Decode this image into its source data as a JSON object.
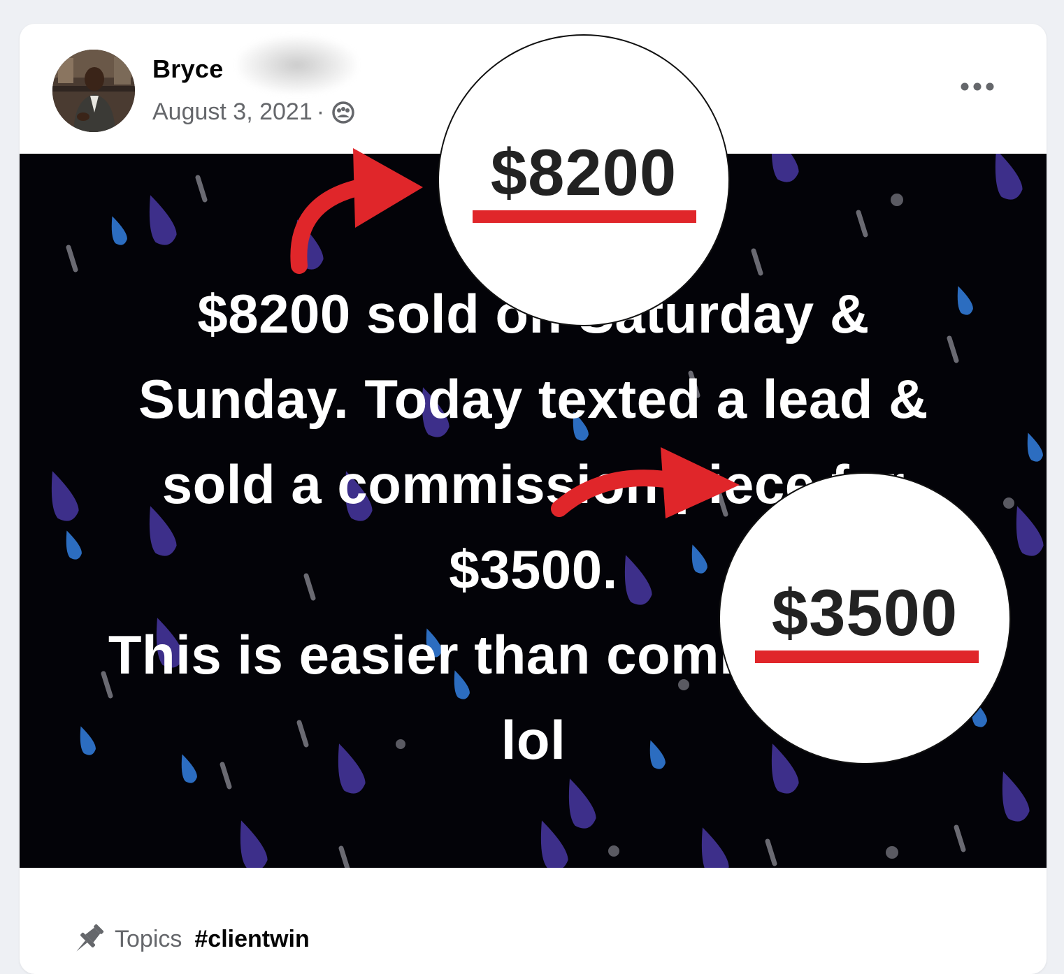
{
  "post": {
    "author_name": "Bryce",
    "date": "August 3, 2021",
    "separator": "·",
    "audience_icon": "members-icon",
    "more_icon": "more-options-icon",
    "image_text": "$8200 sold on Saturday &\nSunday. Today texted a lead &\nsold a commission piece for\n$3500.\nThis is easier than commissions\nlol"
  },
  "callouts": [
    {
      "value": "$8200",
      "underline_color": "#e0262a"
    },
    {
      "value": "$3500",
      "underline_color": "#e0262a"
    }
  ],
  "topics": {
    "icon": "pin-icon",
    "label": "Topics",
    "tag": "#clientwin"
  },
  "colors": {
    "background": "#eef0f4",
    "card": "#ffffff",
    "image_background": "#030308",
    "accent_red": "#e0262a",
    "secondary_text": "#65676b"
  }
}
